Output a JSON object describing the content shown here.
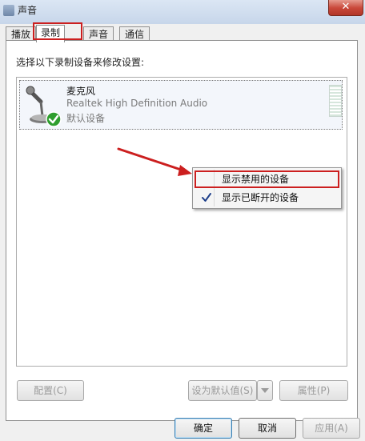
{
  "window": {
    "title": "声音",
    "close_glyph": "✕"
  },
  "tabs": [
    {
      "label": "播放",
      "active": false
    },
    {
      "label": "录制",
      "active": true
    },
    {
      "label": "声音",
      "active": false
    },
    {
      "label": "通信",
      "active": false
    }
  ],
  "instruction": "选择以下录制设备来修改设置:",
  "devices": [
    {
      "name": "麦克风",
      "driver": "Realtek High Definition Audio",
      "status": "默认设备",
      "icon": "microphone-icon",
      "status_icon": "green-check-icon"
    }
  ],
  "context_menu": {
    "items": [
      {
        "label": "显示禁用的设备",
        "checked": false
      },
      {
        "label": "显示已断开的设备",
        "checked": true
      }
    ]
  },
  "buttons": {
    "configure": "配置(C)",
    "set_default": "设为默认值(S)",
    "properties": "属性(P)",
    "ok": "确定",
    "cancel": "取消",
    "apply": "应用(A)"
  },
  "colors": {
    "annotation_red": "#cc1f1f",
    "check_green": "#2e9e2e",
    "check_blue": "#1e3f8a"
  }
}
